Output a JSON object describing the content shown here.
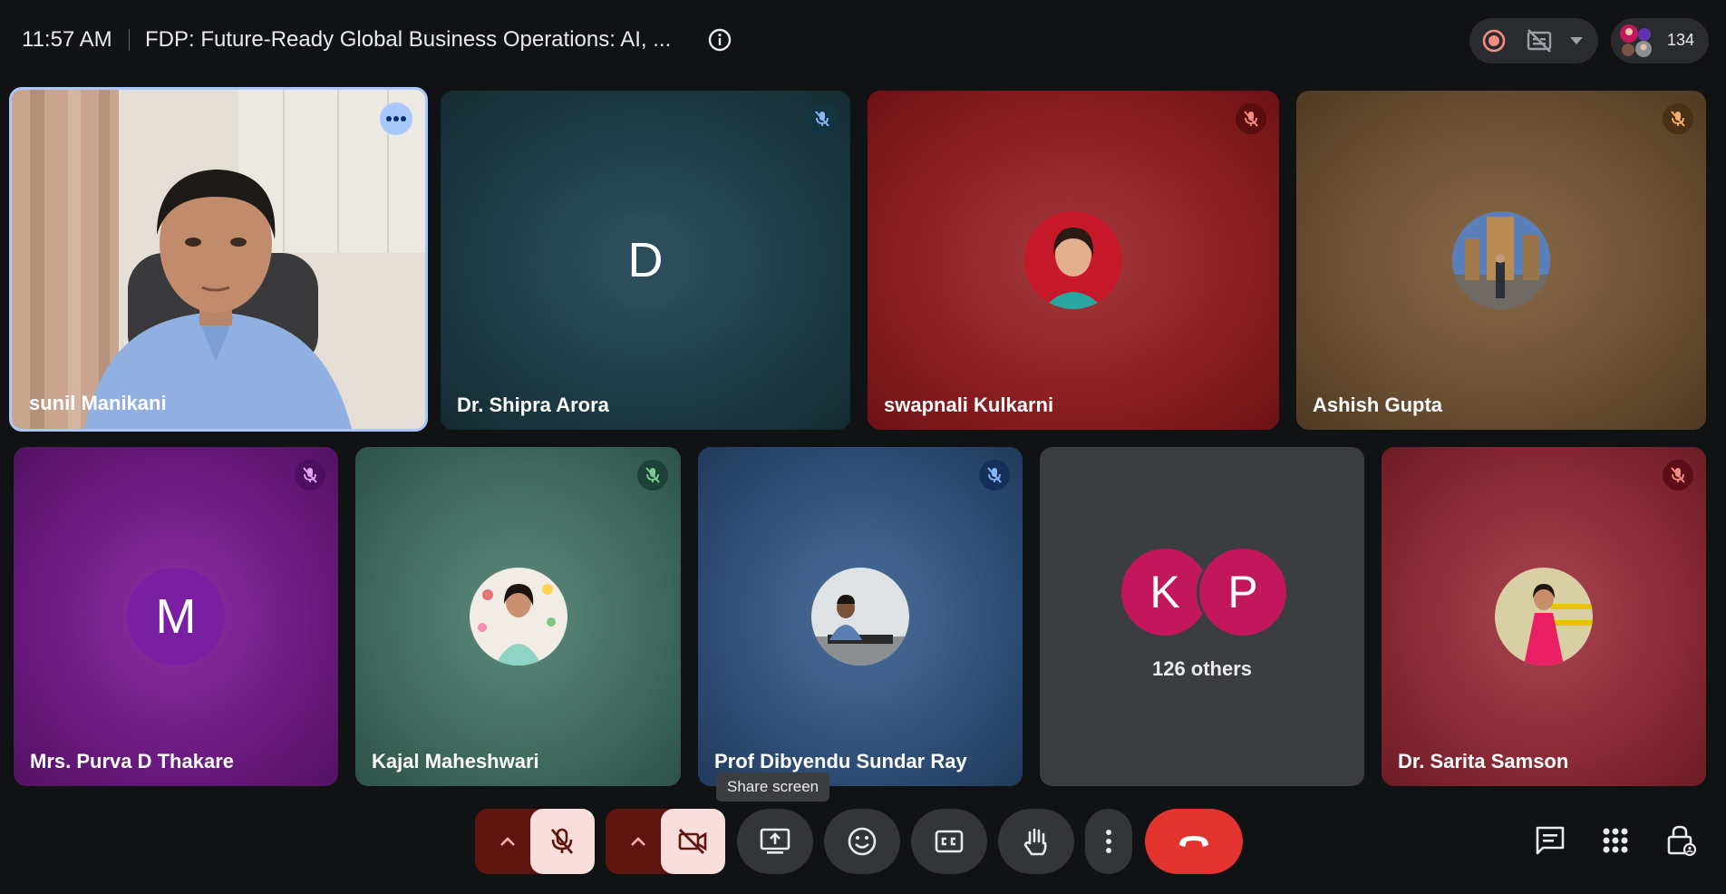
{
  "header": {
    "time": "11:57 AM",
    "meeting_title": "FDP: Future-Ready Global Business Operations: AI, ...",
    "participant_count": "134"
  },
  "tiles": [
    {
      "name": "sunil Manikani",
      "type": "video",
      "muted": false
    },
    {
      "name": "Dr. Shipra Arora",
      "type": "letter",
      "letter": "D",
      "muted": true
    },
    {
      "name": "swapnali Kulkarni",
      "type": "photo",
      "muted": true
    },
    {
      "name": "Ashish Gupta",
      "type": "photo",
      "muted": true
    },
    {
      "name": "Mrs. Purva D Thakare",
      "type": "letter",
      "letter": "M",
      "muted": true
    },
    {
      "name": "Kajal Maheshwari",
      "type": "photo",
      "muted": true
    },
    {
      "name": "Prof Dibyendu Sundar Ray",
      "type": "photo",
      "muted": true
    },
    {
      "name": "Dr. Sarita Samson",
      "type": "photo",
      "muted": true
    }
  ],
  "others": {
    "letters": [
      "K",
      "P"
    ],
    "label": "126 others"
  },
  "toolbar": {
    "tooltip": "Share screen",
    "buttons": [
      "mic-options",
      "mic-toggle",
      "camera-options",
      "camera-toggle",
      "share-screen",
      "reactions",
      "captions",
      "raise-hand",
      "more-options",
      "leave-call"
    ]
  },
  "icons": [
    "info-icon",
    "record-icon",
    "no-captions-icon",
    "chevron-down-icon",
    "mic-off-icon",
    "more-dots-icon",
    "chat-icon",
    "apps-grid-icon",
    "host-controls-icon"
  ],
  "colors": {
    "background": "#111214",
    "leave": "#e3342f",
    "mic_off_bg": "#f9dedc",
    "accent_blue": "#a8c7fa",
    "others_avatar": "#c2185b"
  }
}
